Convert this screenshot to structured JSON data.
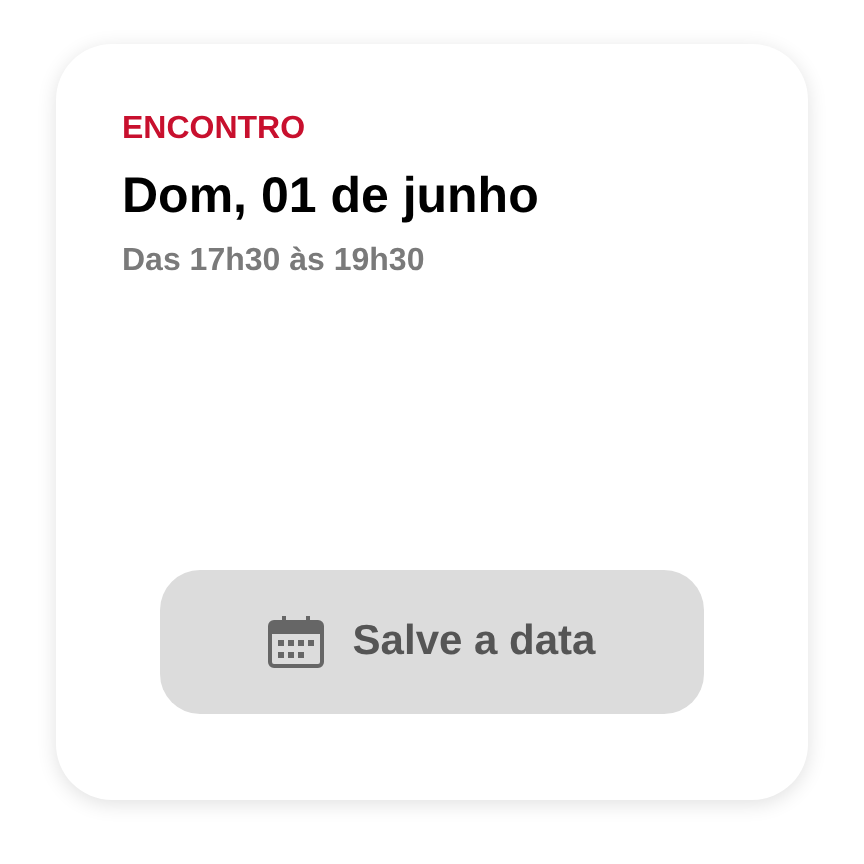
{
  "event": {
    "category": "ENCONTRO",
    "title": "Dom, 01 de junho",
    "time": "Das 17h30 às 19h30"
  },
  "button": {
    "label": "Salve a data"
  }
}
